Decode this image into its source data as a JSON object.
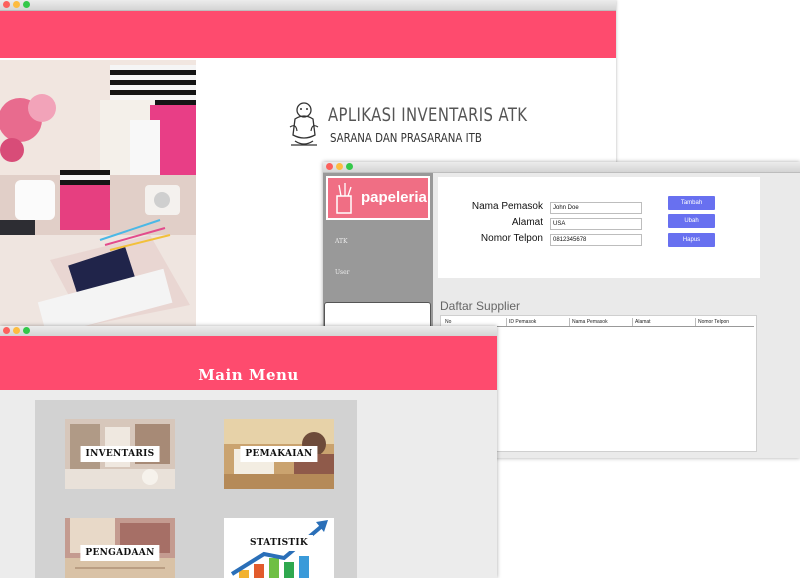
{
  "inventory_app": {
    "title": "APLIKASI INVENTARIS ATK",
    "subtitle": "SARANA DAN PRASARANA ITB"
  },
  "supplier_window": {
    "logo_text": "papeleria",
    "sidebar_items": [
      "ATK",
      "User"
    ],
    "form": {
      "supplier_name_label": "Nama Pemasok",
      "supplier_name_value": "John Doe",
      "address_label": "Alamat",
      "address_value": "USA",
      "phone_label": "Nomor Telpon",
      "phone_value": "0812345678"
    },
    "buttons": {
      "add": "Tambah",
      "edit": "Ubah",
      "delete": "Hapus"
    },
    "list_title": "Daftar Supplier",
    "table_columns": [
      "No",
      "ID Pemasok",
      "Nama Pemasok",
      "Alamat",
      "Nomor Telpon"
    ]
  },
  "main_menu": {
    "title": "Main Menu",
    "tiles": [
      "INVENTARIS",
      "PEMAKAIAN",
      "PENGADAAN",
      "STATISTIK"
    ]
  },
  "colors": {
    "accent_pink": "#fe4b6e",
    "button_blue": "#6870f0",
    "sidebar_gray": "#999999"
  }
}
